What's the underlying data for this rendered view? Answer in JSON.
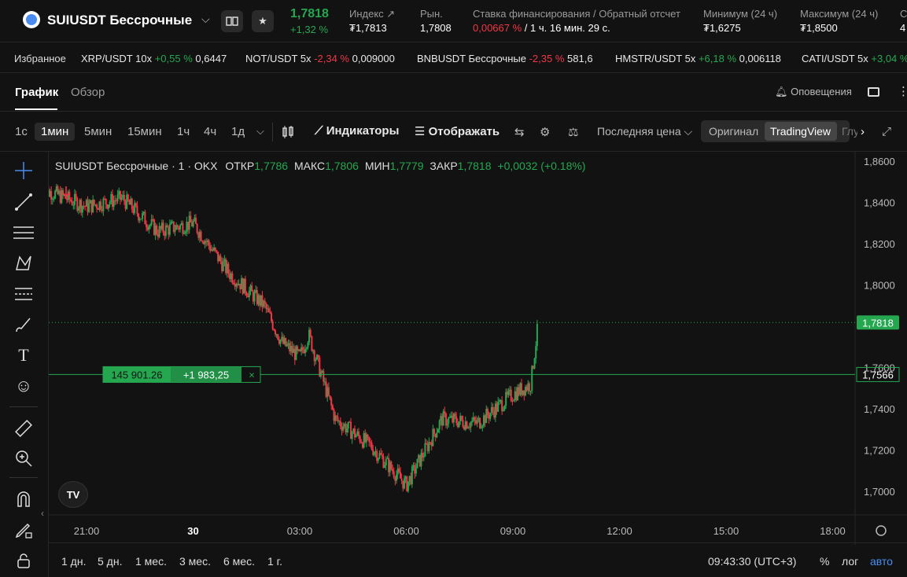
{
  "header": {
    "pair_title": "SUIUSDT Бессрочные",
    "last_price": "1,7818",
    "change_pct": "+1,32 %",
    "index_label": "Индекс",
    "index_value": "₮1,7813",
    "market_label": "Рын.",
    "market_value": "1,7808",
    "funding_label": "Ставка финансирования / Обратный отсчет",
    "funding_rate": "0,00667 %",
    "funding_countdown": "/ 1 ч. 16 мин. 29 с.",
    "low_label": "Минимум (24 ч)",
    "low_value": "₮1,6275",
    "high_label": "Максимум (24 ч)",
    "high_value": "₮1,8500",
    "cut_label": "С",
    "cut_value": "4"
  },
  "favorites": {
    "label": "Избранное",
    "items": [
      {
        "name": "XRP/USDT 10x",
        "change": "+0,55 %",
        "price": "0,6447",
        "dir": "up"
      },
      {
        "name": "NOT/USDT 5x",
        "change": "-2,34 %",
        "price": "0,009000",
        "dir": "down"
      },
      {
        "name": "BNBUSDT Бессрочные",
        "change": "-2,35 %",
        "price": "581,6",
        "dir": "down"
      },
      {
        "name": "HMSTR/USDT 5x",
        "change": "+6,18 %",
        "price": "0,006118",
        "dir": "up"
      },
      {
        "name": "CATI/USDT 5x",
        "change": "+3,04 %",
        "price": "",
        "dir": "up"
      }
    ]
  },
  "tabs": {
    "chart": "График",
    "overview": "Обзор",
    "alerts": "Оповещения"
  },
  "toolbar": {
    "timeframes": [
      "1с",
      "1мин",
      "5мин",
      "15мин",
      "1ч",
      "4ч",
      "1д"
    ],
    "active_timeframe": "1мин",
    "indicators": "Индикаторы",
    "display": "Отображать",
    "price_type": "Последняя цена",
    "view_original": "Оригинал",
    "view_tradingview": "TradingView",
    "view_depth": "Глу"
  },
  "legend": {
    "symbol": "SUIUSDT Бессрочные · 1 · OKX",
    "open_label": "ОТКР",
    "open": "1,7786",
    "high_label": "МАКС",
    "high": "1,7806",
    "low_label": "МИН",
    "low": "1,7779",
    "close_label": "ЗАКР",
    "close": "1,7818",
    "change": "+0,0032 (+0.18%)"
  },
  "position": {
    "size": "145 901.26",
    "pnl": "+1 983,25",
    "close_glyph": "×"
  },
  "price_labels": {
    "last": "1,7818",
    "position": "1,7566"
  },
  "bottom": {
    "ranges": [
      "1 дн.",
      "5 дн.",
      "1 мес.",
      "3 мес.",
      "6 мес.",
      "1 г."
    ],
    "time": "09:43:30 (UTC+3)",
    "pct": "%",
    "log": "лог",
    "auto": "авто"
  },
  "colors": {
    "up": "#25a750",
    "down": "#f23645",
    "accent": "#4a8cf0"
  },
  "chart_data": {
    "type": "candlestick",
    "y_ticks": [
      "1,8600",
      "1,8400",
      "1,8200",
      "1,8000",
      "1,7600",
      "1,7400",
      "1,7200",
      "1,7000"
    ],
    "ylim": [
      1.695,
      1.865
    ],
    "x_ticks": [
      "21:00",
      "30",
      "03:00",
      "06:00",
      "09:00",
      "12:00",
      "15:00",
      "18:00"
    ],
    "xlim": [
      "29 19:45",
      "30 20:00"
    ],
    "key_points": [
      {
        "time": "20:00",
        "price": 1.845
      },
      {
        "time": "21:00",
        "price": 1.838
      },
      {
        "time": "22:00",
        "price": 1.842
      },
      {
        "time": "23:00",
        "price": 1.826
      },
      {
        "time": "00:00",
        "price": 1.83
      },
      {
        "time": "01:00",
        "price": 1.806
      },
      {
        "time": "02:00",
        "price": 1.79
      },
      {
        "time": "02:30",
        "price": 1.772
      },
      {
        "time": "03:00",
        "price": 1.765
      },
      {
        "time": "03:15",
        "price": 1.776
      },
      {
        "time": "04:00",
        "price": 1.735
      },
      {
        "time": "05:00",
        "price": 1.722
      },
      {
        "time": "06:00",
        "price": 1.703
      },
      {
        "time": "07:00",
        "price": 1.735
      },
      {
        "time": "08:00",
        "price": 1.733
      },
      {
        "time": "09:00",
        "price": 1.747
      },
      {
        "time": "09:30",
        "price": 1.752
      },
      {
        "time": "09:43",
        "price": 1.7818
      }
    ]
  }
}
